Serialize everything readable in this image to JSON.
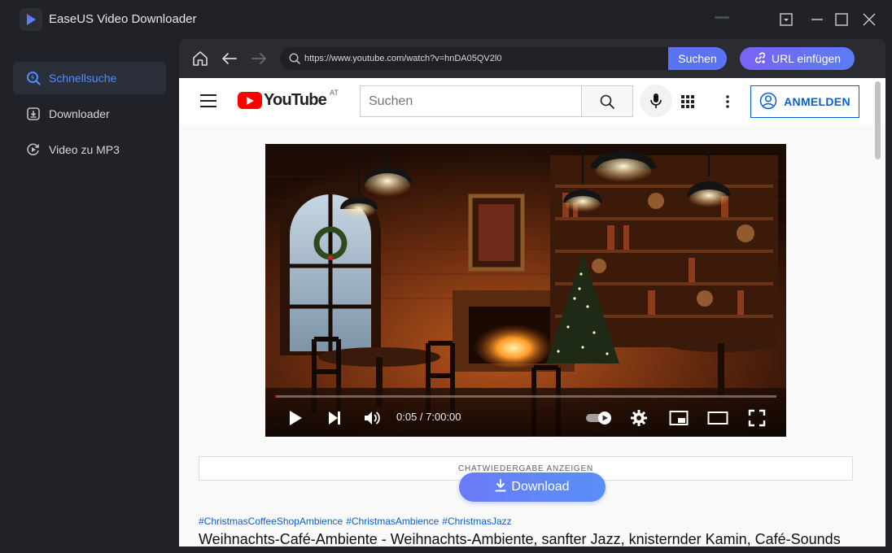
{
  "app": {
    "title": "EaseUS Video Downloader"
  },
  "sidebar": {
    "items": [
      {
        "label": "Schnellsuche",
        "icon": "search-bolt-icon",
        "active": true
      },
      {
        "label": "Downloader",
        "icon": "download-box-icon",
        "active": false
      },
      {
        "label": "Video zu MP3",
        "icon": "convert-mp3-icon",
        "active": false
      }
    ]
  },
  "browser": {
    "url": "https://www.youtube.com/watch?v=hnDA05QV2l0",
    "search_label": "Suchen",
    "paste_url_label": "URL einfügen"
  },
  "youtube": {
    "logo_text": "YouTube",
    "country": "AT",
    "search_placeholder": "Suchen",
    "signin_label": "ANMELDEN",
    "player": {
      "time": "0:05 / 7:00:00",
      "progress": 0.0002
    },
    "chat_replay_label": "CHATWIEDERGABE ANZEIGEN",
    "download_label": "Download",
    "hashtags": [
      "#ChristmasCoffeeShopAmbience",
      "#ChristmasAmbience",
      "#ChristmasJazz"
    ],
    "video_title": "Weihnachts-Café-Ambiente - Weihnachts-Ambiente, sanfter Jazz, knisternder Kamin, Café-Sounds"
  },
  "colors": {
    "accent": "#4d8dff",
    "search_button": "#5b73f2",
    "youtube_red": "#ff0000",
    "signin_blue": "#065fd4"
  }
}
